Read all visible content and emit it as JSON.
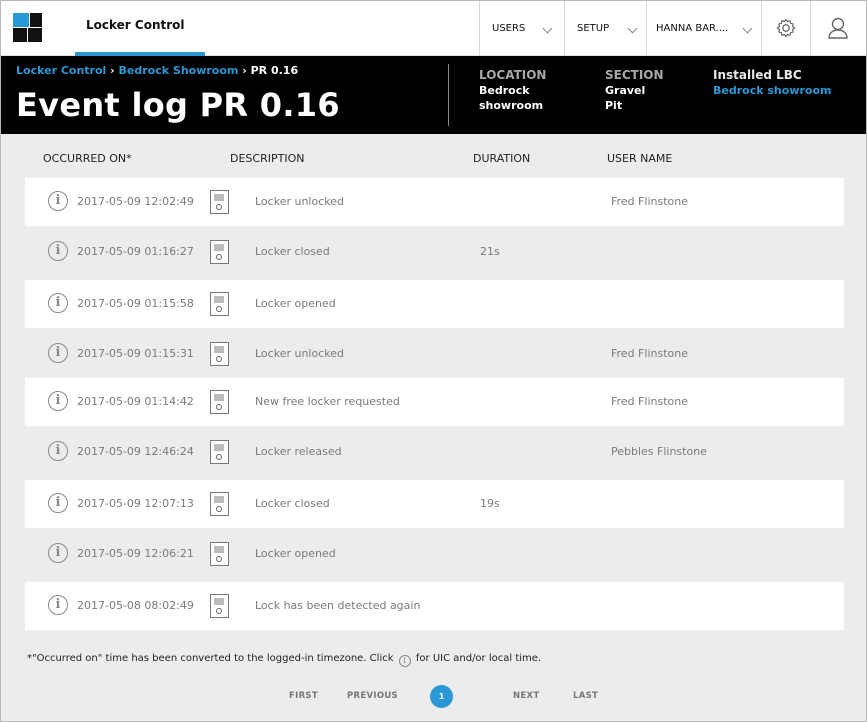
{
  "app": {
    "name": "Locker Control",
    "accent": "#2a98d5"
  },
  "nav": {
    "users": "USERS",
    "setup": "SETUP",
    "account": "HANNA BAR...."
  },
  "breadcrumb": {
    "items": [
      "Locker Control",
      "Bedrock Showroom"
    ],
    "separator": "›",
    "current": "PR 0.16"
  },
  "page_title": "Event log PR 0.16",
  "meta": {
    "location_label": "LOCATION",
    "location_value_1": "Bedrock",
    "location_value_2": "showroom",
    "section_label": "SECTION",
    "section_value_1": "Gravel",
    "section_value_2": "Pit",
    "lbc_label": "Installed LBC",
    "lbc_value": "Bedrock showroom"
  },
  "table": {
    "columns": [
      "OCCURRED ON*",
      "DESCRIPTION",
      "DURATION",
      "USER NAME"
    ],
    "rows": [
      {
        "occurred_on": "2017-05-09 12:02:49",
        "description": "Locker unlocked",
        "duration": "",
        "user": "Fred Flinstone"
      },
      {
        "occurred_on": "2017-05-09 01:16:27",
        "description": "Locker closed",
        "duration": "21s",
        "user": ""
      },
      {
        "occurred_on": "2017-05-09 01:15:58",
        "description": "Locker opened",
        "duration": "",
        "user": ""
      },
      {
        "occurred_on": "2017-05-09 01:15:31",
        "description": "Locker unlocked",
        "duration": "",
        "user": "Fred Flinstone"
      },
      {
        "occurred_on": "2017-05-09 01:14:42",
        "description": "New free locker requested",
        "duration": "",
        "user": "Fred Flinstone"
      },
      {
        "occurred_on": "2017-05-09 12:46:24",
        "description": "Locker released",
        "duration": "",
        "user": "Pebbles Flinstone"
      },
      {
        "occurred_on": "2017-05-09 12:07:13",
        "description": "Locker closed",
        "duration": "19s",
        "user": ""
      },
      {
        "occurred_on": "2017-05-09 12:06:21",
        "description": "Locker opened",
        "duration": "",
        "user": ""
      },
      {
        "occurred_on": "2017-05-08 08:02:49",
        "description": "Lock has been detected again",
        "duration": "",
        "user": ""
      }
    ]
  },
  "footnote": {
    "before": "*\"Occurred on\" time has been converted to the logged-in timezone. Click",
    "after": "for UIC and/or local time."
  },
  "pagination": {
    "first": "FIRST",
    "previous": "PREVIOUS",
    "current": "1",
    "next": "NEXT",
    "last": "LAST"
  }
}
